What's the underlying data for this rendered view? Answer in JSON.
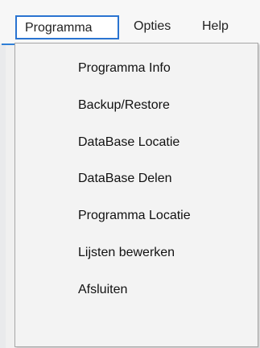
{
  "menubar": {
    "items": [
      {
        "label": "Programma"
      },
      {
        "label": "Opties"
      },
      {
        "label": "Help"
      }
    ]
  },
  "dropdown": {
    "items": [
      {
        "label": "Programma Info"
      },
      {
        "label": "Backup/Restore"
      },
      {
        "label": "DataBase Locatie"
      },
      {
        "label": "DataBase Delen"
      },
      {
        "label": "Programma Locatie"
      },
      {
        "label": "Lijsten bewerken"
      },
      {
        "label": "Afsluiten"
      }
    ]
  },
  "colors": {
    "active_border": "#2a74d1",
    "menu_background": "#f3f3f3"
  }
}
